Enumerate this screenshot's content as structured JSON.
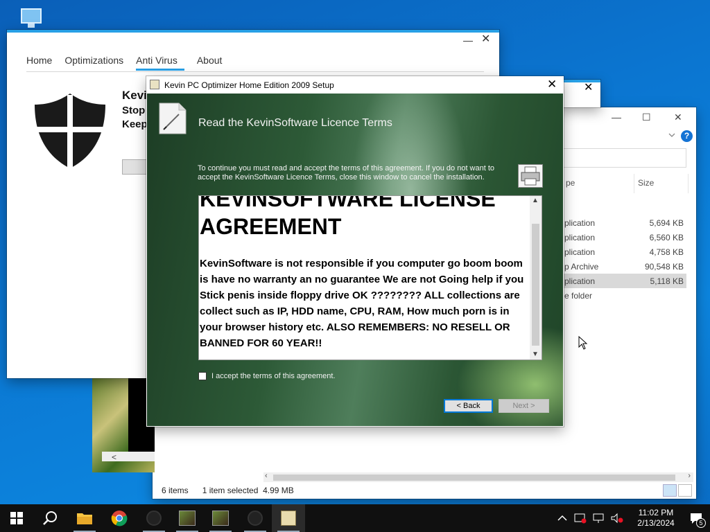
{
  "desktop": {
    "icon": "monitor-icon"
  },
  "explorer": {
    "controls": {
      "minimize": "—",
      "maximize": "☐",
      "close": "✕"
    },
    "columns": {
      "type": "pe",
      "size": "Size"
    },
    "rows": [
      {
        "type": "plication",
        "size": "5,694 KB"
      },
      {
        "type": "plication",
        "size": "6,560 KB"
      },
      {
        "type": "plication",
        "size": "4,758 KB"
      },
      {
        "type": "p Archive",
        "size": "90,548 KB"
      },
      {
        "type": "plication",
        "size": "5,118 KB"
      },
      {
        "type": "e folder",
        "size": ""
      }
    ],
    "status": {
      "items": "6 items",
      "selected": "1 item selected",
      "size": "4.99 MB"
    }
  },
  "optimizer": {
    "nav": [
      "Home",
      "Optimizations",
      "Anti Virus",
      "About"
    ],
    "controls": {
      "minimize": "—",
      "close": "✕"
    },
    "heading": "Kevi",
    "line2": "Stop",
    "line3": "Keep"
  },
  "smallwin": {
    "close": "✕"
  },
  "setup": {
    "title": "Kevin PC Optimizer Home Edition 2009 Setup",
    "close": "✕",
    "header": "Read the KevinSoftware Licence Terms",
    "intro": "To continue you must read and accept the terms of this agreement. If you do not want to accept the KevinSoftware Licence Terms, close this window to cancel the installation.",
    "license_cut": "KEVINSOFTWARE LICENSE",
    "license_title": "AGREEMENT",
    "license_body": "KevinSoftware is not responsible if you computer go boom boom is have no warranty an no guarantee We are not Going help if you Stick penis inside floppy drive OK ???????? ALL collections are collect such as IP, HDD name, CPU, RAM, How much porn is in your browser history etc. ALSO REMEMBERS: NO RESELL OR BANNED FOR 60 YEAR!!",
    "accept_label": "I accept the terms of this agreement.",
    "back": "< Back",
    "next": "Next >"
  },
  "taskbar": {
    "time": "11:02 PM",
    "date": "2/13/2024",
    "notifications": "5"
  },
  "colors": {
    "accent": "#28a0e6",
    "taskbar": "#101010",
    "desktop": "#0b76d1"
  }
}
